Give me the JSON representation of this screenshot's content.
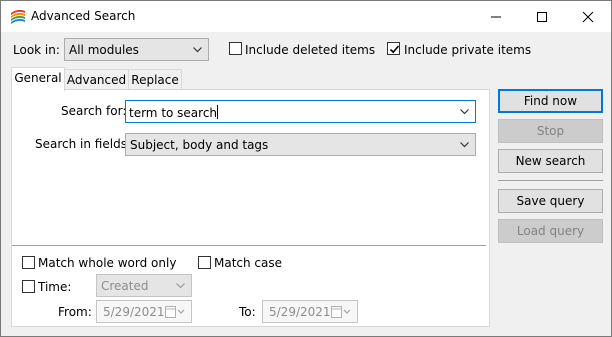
{
  "window": {
    "title": "Advanced Search",
    "icon": "app-icon"
  },
  "titlebar_buttons": [
    "minimize-icon",
    "maximize-icon",
    "close-icon"
  ],
  "look_in": {
    "label": "Look in:",
    "value": "All modules"
  },
  "options": {
    "include_deleted": {
      "label": "Include deleted items",
      "checked": false
    },
    "include_private": {
      "label": "Include private items",
      "checked": true
    }
  },
  "tabs": [
    {
      "label": "General",
      "active": true
    },
    {
      "label": "Advanced",
      "active": false
    },
    {
      "label": "Replace",
      "active": false
    }
  ],
  "general": {
    "search_for": {
      "label": "Search for:",
      "value": "term to search"
    },
    "search_in_fields": {
      "label": "Search in fields:",
      "value": "Subject, body and tags"
    },
    "match_whole_word": {
      "label": "Match whole word only",
      "checked": false
    },
    "match_case": {
      "label": "Match case",
      "checked": false
    },
    "time": {
      "label": "Time:",
      "checked": false,
      "value": "Created"
    },
    "from": {
      "label": "From:",
      "value": "5/29/2021"
    },
    "to": {
      "label": "To:",
      "value": "5/29/2021"
    }
  },
  "buttons": {
    "find_now": "Find now",
    "stop": "Stop",
    "new_search": "New search",
    "save_query": "Save query",
    "load_query": "Load query"
  },
  "colors": {
    "accent": "#0078d7",
    "window_bg": "#f0f0f0",
    "disabled_text": "#838383"
  }
}
